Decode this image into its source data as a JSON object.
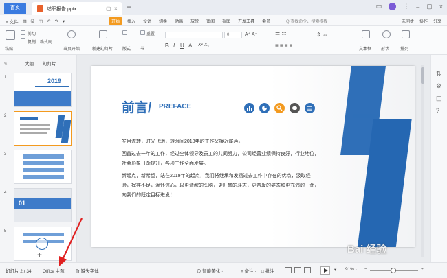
{
  "window": {
    "home_tab": "首页",
    "doc_title": "述职报告.pptx",
    "tab_controls": [
      "▢",
      "×"
    ],
    "new_tab": "+"
  },
  "menubar": {
    "file": "≡ 文件",
    "tabs": [
      "开始",
      "插入",
      "设计",
      "切换",
      "动画",
      "放映",
      "审阅",
      "视图",
      "开发工具",
      "会员"
    ],
    "active_tab": "开始",
    "search": "Q 查找命令、搜索模板",
    "right": [
      "未同步",
      "协作",
      "分享"
    ]
  },
  "ribbon": {
    "paste": "粘贴",
    "cut": "剪切",
    "copy": "复制",
    "format_painter": "格式刷",
    "play_from_current": "当页开始",
    "new_slide": "新建幻灯片",
    "layout": "版式",
    "section": "节",
    "reset": "重置",
    "font_size": "0",
    "text_box": "文本框",
    "shape": "形状",
    "arrange": "排列"
  },
  "left_pane": {
    "tabs": [
      "大纲",
      "幻灯片"
    ],
    "active_tab": "幻灯片",
    "slide_numbers": [
      "1",
      "2",
      "3",
      "4",
      "5"
    ],
    "thumb1_year": "2019",
    "thumb4_label": "01",
    "add": "+"
  },
  "slide": {
    "title_cn": "前言/",
    "title_en": "PREFACE",
    "para1": "岁月流转，时光飞驰，转眼间2018年的工作又接近尾声。",
    "para2": "回首过去一年的工作，经过全体领导及员工的共同努力，公司经营业绩保持良好，行业地位，社会形象日渐提升，各项工作全面发展。",
    "para3": "新起点，新希望，站在2019年的起点，我们将继承和发扬过去工作中存在的优点，汲取经验，摒弃不足，满怀信心，以更清醒的头脑，更旺盛的斗志，更奋发的姿态和更充沛的干劲，向我们的既定目标进发！",
    "icons": [
      "bar-chart-icon",
      "pie-chart-icon",
      "search-icon",
      "toggle-icon",
      "list-icon"
    ],
    "icon_colors": [
      "#2f6fb8",
      "#2f6fb8",
      "#f39a1f",
      "#555555",
      "#2f6fb8"
    ]
  },
  "statusbar": {
    "slide_count": "幻灯片 2 / 34",
    "theme": "Office 主题",
    "missing_font": "Tr 缺失字体",
    "smart_beautify": "⊙ 智能美化 ·",
    "notes": "≡ 备注 ·",
    "comments": "□ 批注",
    "zoom": "91% ·",
    "zoom_minus": "−",
    "zoom_plus": "+"
  },
  "watermark": "Bai 经验",
  "colors": {
    "accent_blue": "#2f6fb8",
    "accent_orange": "#f39a1f",
    "home_blue": "#3a7be0",
    "arrow_red": "#e02020"
  }
}
